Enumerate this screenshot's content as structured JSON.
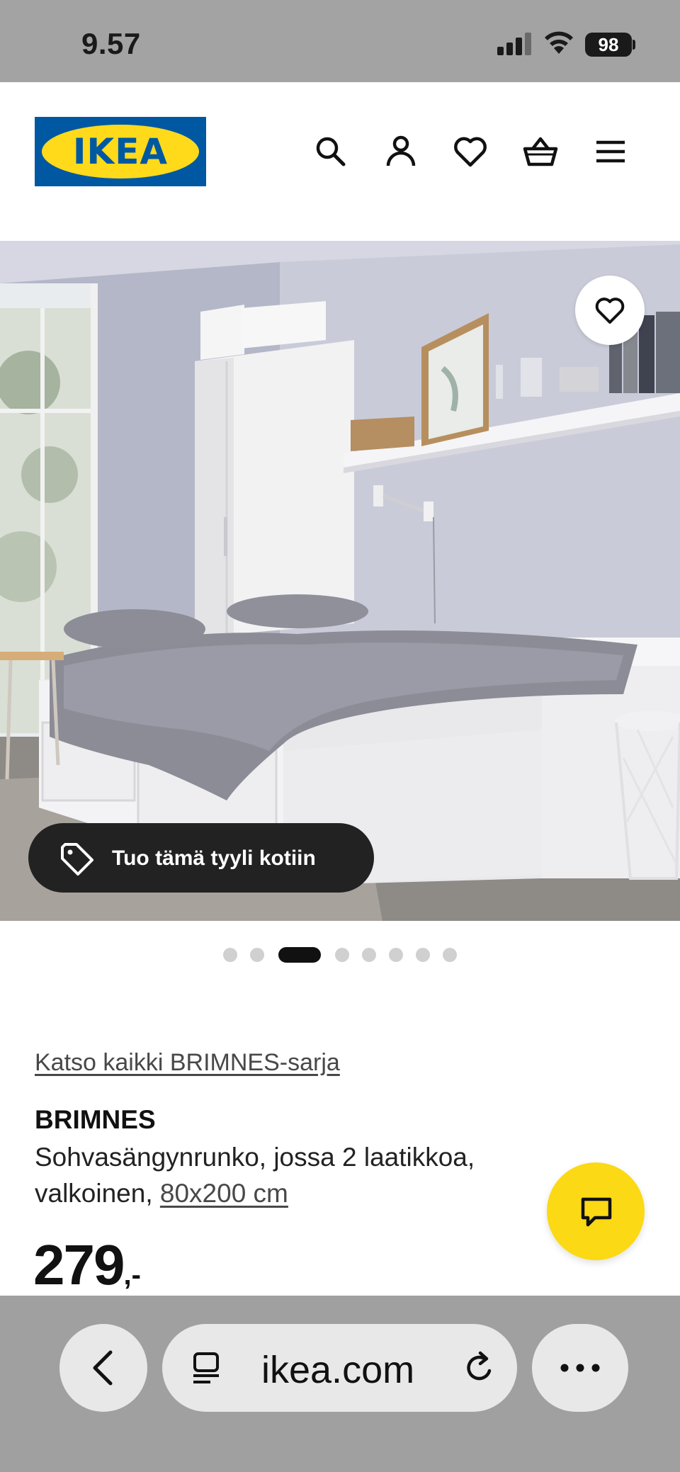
{
  "status_bar": {
    "time": "9.57",
    "battery": "98"
  },
  "header": {
    "logo_text": "IKEA",
    "icons": [
      "search-icon",
      "account-icon",
      "favourites-icon",
      "basket-icon",
      "menu-icon"
    ]
  },
  "hero": {
    "style_button_label": "Tuo tämä tyyli kotiin",
    "pager": {
      "total": 8,
      "active_index": 2
    }
  },
  "product": {
    "series_link": "Katso kaikki BRIMNES-sarja",
    "name": "BRIMNES",
    "description": "Sohvasängynrunko, jossa 2 laatikkoa, valkoinen,",
    "size_link": "80x200 cm",
    "price": "279",
    "price_suffix": ",-"
  },
  "browser": {
    "url": "ikea.com"
  },
  "colors": {
    "ikea_blue": "#0058a3",
    "ikea_yellow": "#ffda1a",
    "chat_yellow": "#fbd914",
    "dark_pill": "#222222"
  }
}
